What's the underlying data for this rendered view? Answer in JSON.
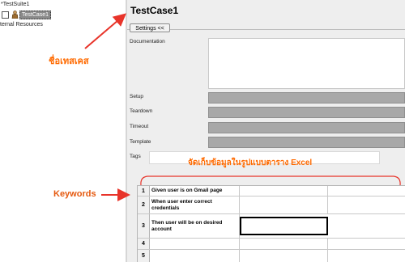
{
  "tree": {
    "suite_label": "*TestSuite1",
    "case_label": "TestCase1",
    "external_label": "ternal Resources"
  },
  "editor": {
    "title": "TestCase1",
    "settings_button": "Settings <<",
    "fields": {
      "documentation": "Documentation",
      "setup": "Setup",
      "teardown": "Teardown",
      "timeout": "Timeout",
      "template": "Template",
      "tags": "Tags"
    }
  },
  "grid": {
    "rows": [
      {
        "num": "1",
        "keyword": "Given user is on Gmail page"
      },
      {
        "num": "2",
        "keyword": "When user enter correct credentials"
      },
      {
        "num": "3",
        "keyword": "Then user will be on desired account"
      },
      {
        "num": "4",
        "keyword": ""
      },
      {
        "num": "5",
        "keyword": ""
      }
    ]
  },
  "annotations": {
    "test_case_name": "ชื่อเทสเคส",
    "keywords": "Keywords",
    "excel_note": "จัดเก็บข้อมูลในรูปแบบตาราง Excel"
  },
  "colors": {
    "annotation_orange": "#ff6a00",
    "arrow_red": "#e8342a",
    "panel_bg": "#eeeeee",
    "disabled_field": "#a8a8a8"
  },
  "icons": {
    "test_case": "person-icon",
    "checkbox": "checkbox-icon"
  }
}
